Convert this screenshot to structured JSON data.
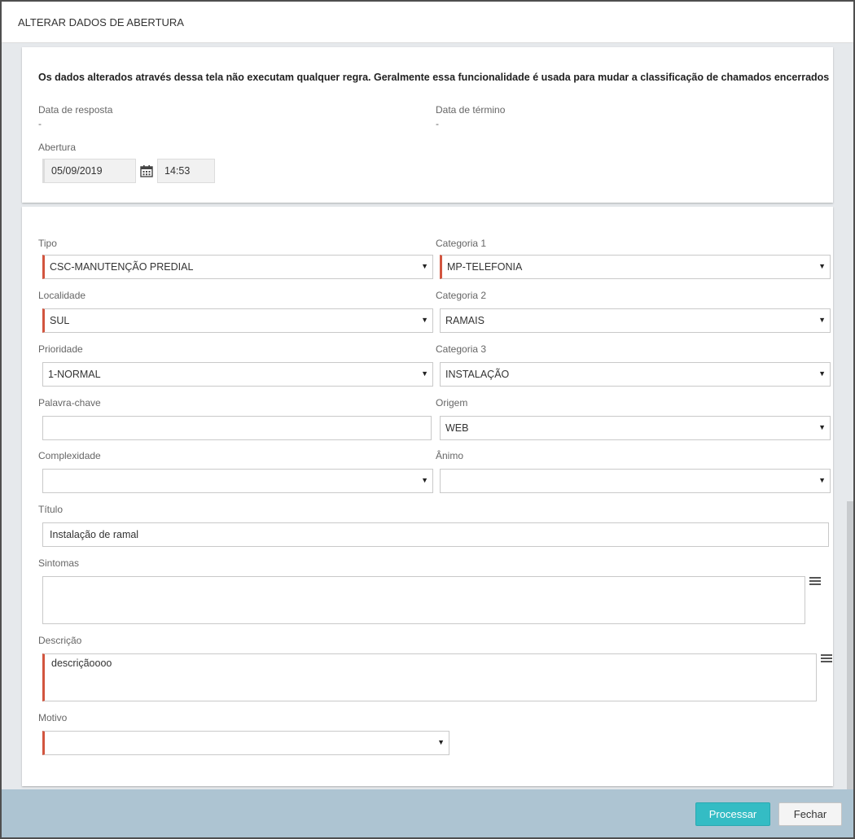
{
  "dialog": {
    "title": "ALTERAR DADOS DE ABERTURA"
  },
  "notice": "Os dados alterados através dessa tela não executam qualquer regra. Geralmente essa funcionalidade é usada para mudar a classificação de chamados encerrados",
  "summary": {
    "data_resposta_label": "Data de resposta",
    "data_resposta_value": "-",
    "data_termino_label": "Data de término",
    "data_termino_value": "-",
    "abertura_label": "Abertura",
    "abertura_date": "05/09/2019",
    "abertura_time": "14:53"
  },
  "form": {
    "tipo": {
      "label": "Tipo",
      "value": "CSC-MANUTENÇÃO PREDIAL"
    },
    "categoria1": {
      "label": "Categoria 1",
      "value": "MP-TELEFONIA"
    },
    "localidade": {
      "label": "Localidade",
      "value": "SUL"
    },
    "categoria2": {
      "label": "Categoria 2",
      "value": "RAMAIS"
    },
    "prioridade": {
      "label": "Prioridade",
      "value": "1-NORMAL"
    },
    "categoria3": {
      "label": "Categoria 3",
      "value": "INSTALAÇÃO"
    },
    "palavra_chave": {
      "label": "Palavra-chave",
      "value": ""
    },
    "origem": {
      "label": "Origem",
      "value": "WEB"
    },
    "complexidade": {
      "label": "Complexidade",
      "value": ""
    },
    "animo": {
      "label": "Ânimo",
      "value": ""
    },
    "titulo": {
      "label": "Título",
      "value": "Instalação de ramal"
    },
    "sintomas": {
      "label": "Sintomas",
      "value": ""
    },
    "descricao": {
      "label": "Descrição",
      "value": "descriçãoooo"
    },
    "motivo": {
      "label": "Motivo",
      "value": ""
    }
  },
  "footer": {
    "processar_label": "Processar",
    "fechar_label": "Fechar"
  },
  "colors": {
    "required_marker": "#d2553f",
    "primary": "#34bcc4",
    "footer_bg": "#adc4d2"
  }
}
